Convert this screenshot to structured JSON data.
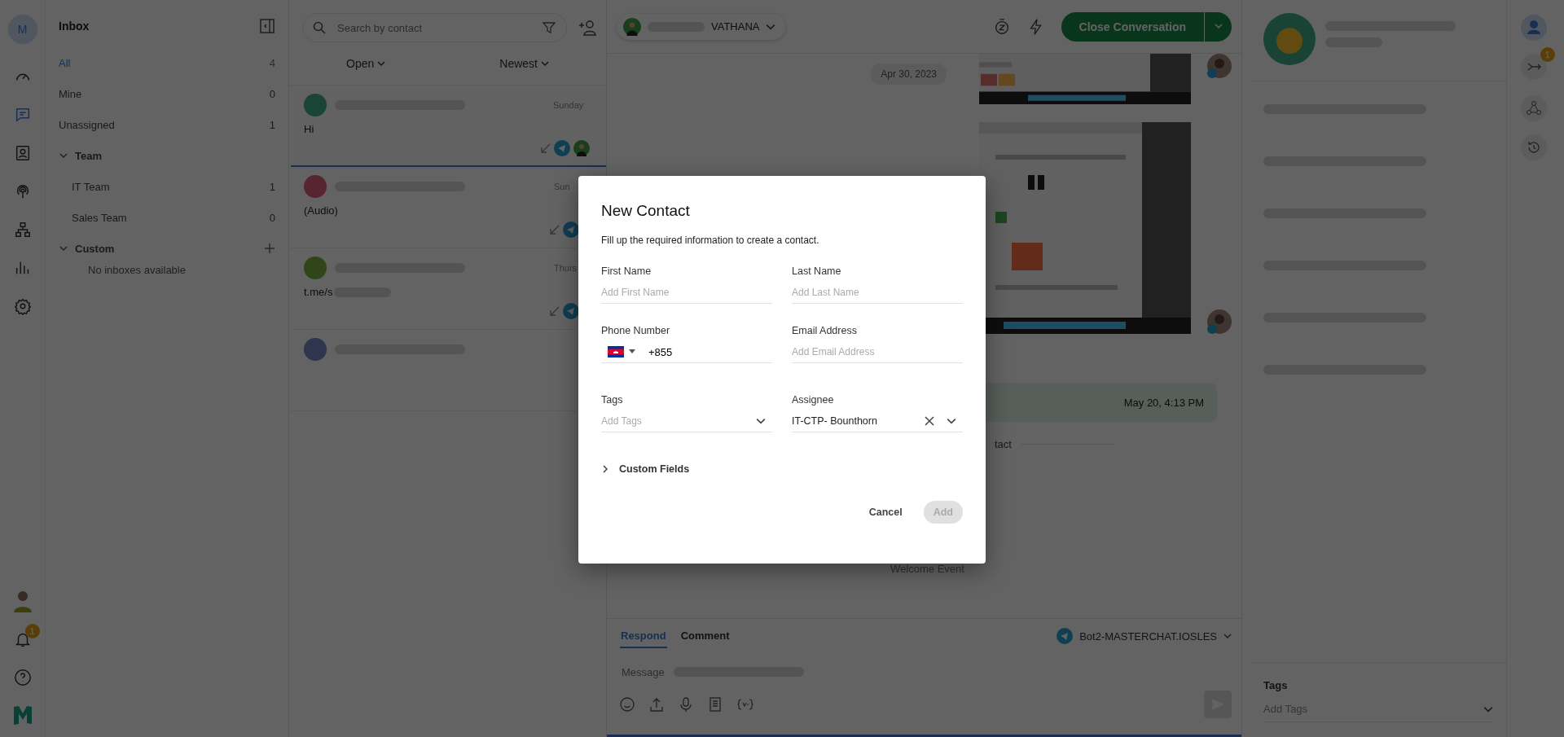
{
  "nav_rail": {
    "avatar": "M",
    "items": [
      {
        "kind": "dashboard",
        "selected": false
      },
      {
        "kind": "chat",
        "selected": true
      },
      {
        "kind": "contacts",
        "selected": false
      },
      {
        "kind": "broadcast",
        "selected": false
      },
      {
        "kind": "hierarchy",
        "selected": false
      },
      {
        "kind": "reports",
        "selected": false
      },
      {
        "kind": "settings",
        "selected": false
      }
    ],
    "notification_badge": "1"
  },
  "inbox_panel": {
    "title": "Inbox",
    "filters": [
      {
        "label": "All",
        "count": "4",
        "selected": true
      },
      {
        "label": "Mine",
        "count": "0",
        "selected": false
      },
      {
        "label": "Unassigned",
        "count": "1",
        "selected": false
      }
    ],
    "groups": [
      {
        "label": "Team",
        "expanded": true,
        "add": false,
        "children": [
          {
            "label": "IT Team",
            "count": "1"
          },
          {
            "label": "Sales Team",
            "count": "0"
          }
        ]
      },
      {
        "label": "Custom",
        "expanded": true,
        "add": true,
        "empty_text": "No inboxes available"
      }
    ]
  },
  "conversation_list": {
    "search": {
      "placeholder": "Search by contact"
    },
    "status_filter": "Open",
    "sort": "Newest",
    "conversations": [
      {
        "time": "Sunday",
        "preview": "Hi",
        "selected": true,
        "color": "#194436",
        "agent_avatar": true
      },
      {
        "time": "Sun",
        "preview": "(Audio)",
        "selected": false,
        "color": "#572531",
        "agent_avatar": false
      },
      {
        "time": "Thurs",
        "preview": "t.me/s",
        "selected": false,
        "color": "#30461a",
        "agent_avatar": false
      },
      {
        "selected": false,
        "color": "#2f344f"
      }
    ]
  },
  "conversation": {
    "agent": "VATHANA",
    "close_button": "Close Conversation",
    "date_chip": "Apr 30, 2023",
    "message_time": "May 20, 4:13 PM",
    "event_fragment": "tact",
    "event": "Welcome Event",
    "composer": {
      "tabs": [
        {
          "label": "Respond",
          "selected": true
        },
        {
          "label": "Comment",
          "selected": false
        }
      ],
      "channel": "Bot2-MASTERCHAT.IOSLES",
      "placeholder": "Message"
    }
  },
  "contact_panel": {
    "tags_title": "Tags",
    "tags_placeholder": "Add Tags",
    "rail_badge": "1"
  },
  "dialog": {
    "title": "New Contact",
    "subtitle": "Fill up the required information to create a contact.",
    "fields": [
      {
        "kind": "text",
        "label": "First Name",
        "placeholder": "Add First Name"
      },
      {
        "kind": "text",
        "label": "Last Name",
        "placeholder": "Add Last Name"
      },
      {
        "kind": "phone",
        "label": "Phone Number",
        "value": "+855"
      },
      {
        "kind": "text",
        "label": "Email Address",
        "placeholder": "Add Email Address"
      },
      {
        "kind": "select",
        "label": "Tags",
        "placeholder": "Add Tags"
      },
      {
        "kind": "select",
        "label": "Assignee",
        "value": "IT-CTP- Bounthorn"
      }
    ],
    "custom_fields": {
      "label": "Custom Fields",
      "expanded": false
    },
    "buttons": [
      {
        "label": "Cancel",
        "kind": "text"
      },
      {
        "label": "Add",
        "kind": "primary",
        "disabled": true
      }
    ]
  }
}
